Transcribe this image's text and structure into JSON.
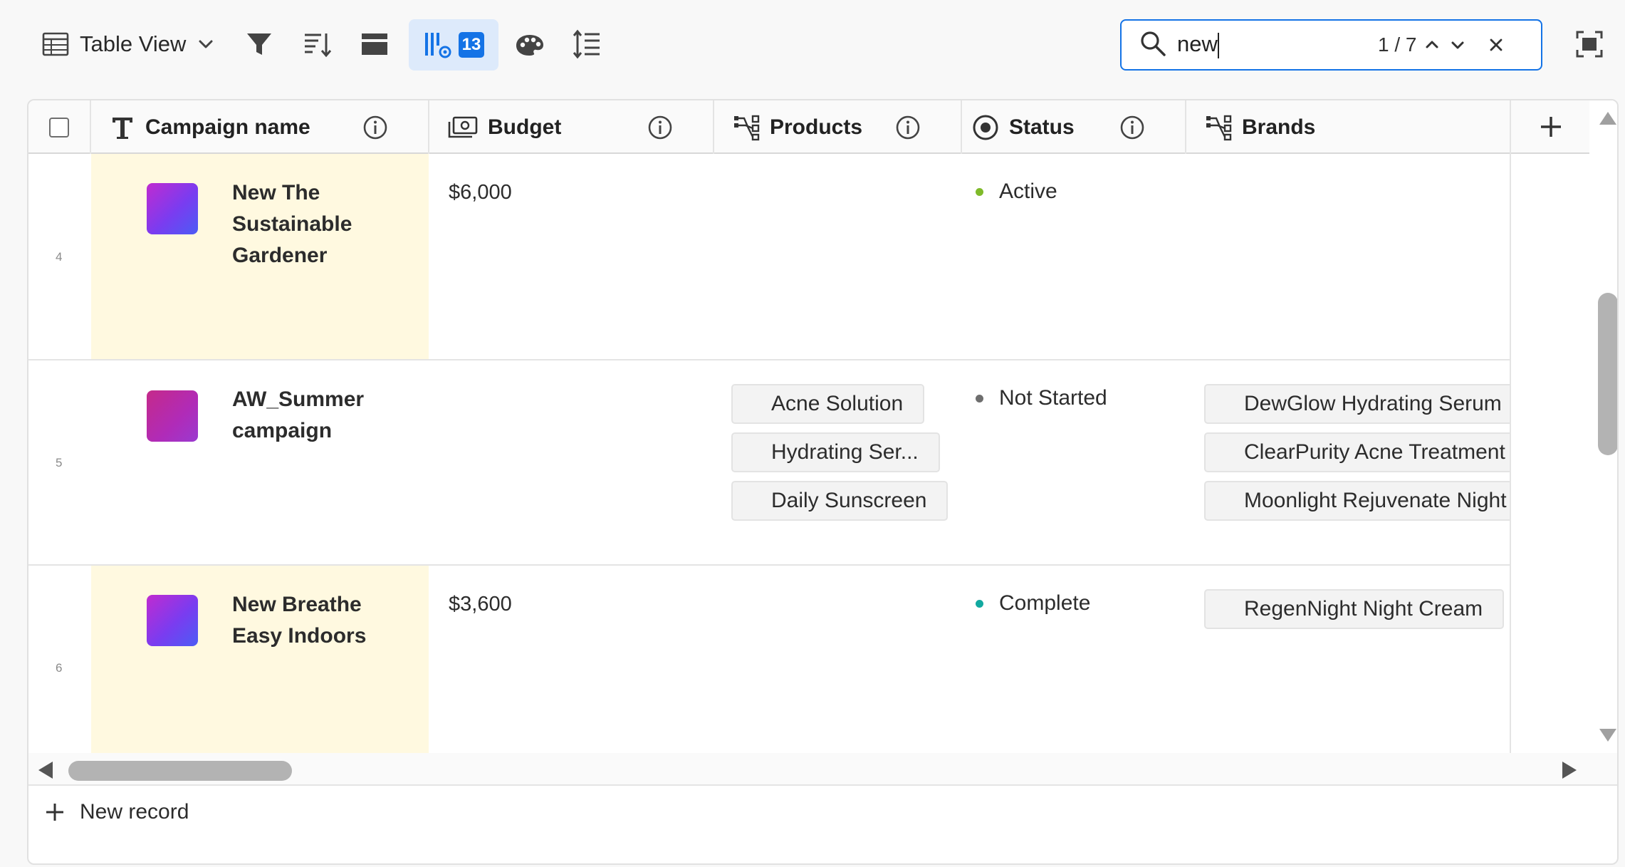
{
  "toolbar": {
    "view_label": "Table View",
    "fields_count": "13"
  },
  "search": {
    "value": "new",
    "match_count": "1 / 7"
  },
  "columns": [
    {
      "label": "Campaign name"
    },
    {
      "label": "Budget"
    },
    {
      "label": "Products"
    },
    {
      "label": "Status"
    },
    {
      "label": "Brands"
    }
  ],
  "rows": [
    {
      "number": "4",
      "name": "New The Sustainable Gardener",
      "budget": "$6,000",
      "products": [],
      "status": "Active",
      "status_color": "#7fba2a",
      "brands": [],
      "highlighted": true
    },
    {
      "number": "5",
      "name": "AW_Summer campaign",
      "budget": "",
      "products": [
        "Acne Solution",
        "Hydrating Ser...",
        "Daily Sunscreen"
      ],
      "status": "Not Started",
      "status_color": "#6e6e6e",
      "brands": [
        "DewGlow Hydrating Serum",
        "ClearPurity Acne Treatment",
        "Moonlight Rejuvenate Night C"
      ],
      "highlighted": false
    },
    {
      "number": "6",
      "name": "New Breathe Easy Indoors",
      "budget": "$3,600",
      "products": [],
      "status": "Complete",
      "status_color": "#12a9a0",
      "brands": [
        "RegenNight Night Cream"
      ],
      "highlighted": true
    }
  ],
  "footer": {
    "new_record_label": "New record"
  },
  "colors": {
    "accent": "#1473e6",
    "highlight": "#fff9e0",
    "fields_button_bg": "#ddeafb"
  }
}
